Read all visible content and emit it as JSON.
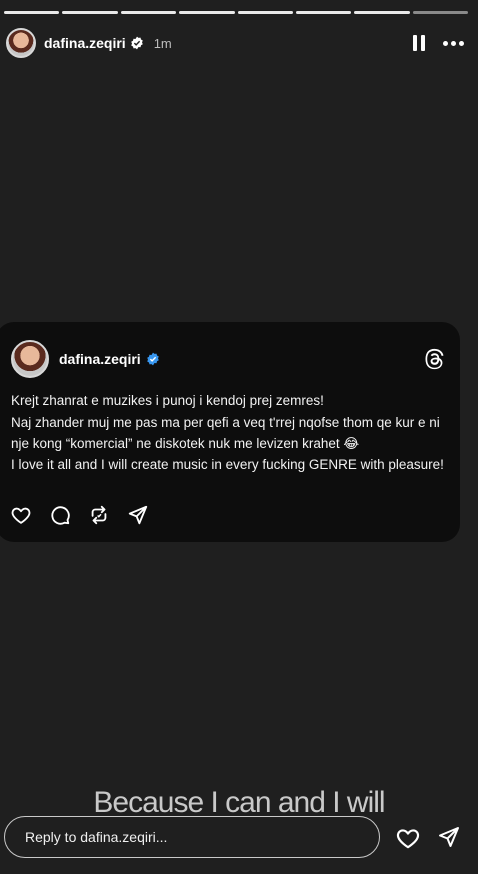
{
  "story": {
    "username": "dafina.zeqiri",
    "time": "1m",
    "segments": 8
  },
  "post": {
    "username": "dafina.zeqiri",
    "lines": [
      "Krejt zhanrat e muzikes i punoj i kendoj prej zemres!",
      "Naj zhander muj me pas ma per qefi a veq t'rrej nqofse thom qe kur e ni nje kong “komercial” ne diskotek nuk me levizen krahet 😂",
      "I love it all and I will create music in every fucking GENRE with pleasure!"
    ]
  },
  "caption": "Because I can and I will",
  "reply": {
    "placeholder": "Reply to dafina.zeqiri..."
  },
  "colors": {
    "background": "#1f1f1f",
    "card": "#0d0d0d",
    "verified": "#3897f0"
  },
  "icons": {
    "verified": "verified-badge-icon",
    "threads": "threads-logo-icon",
    "like": "heart-icon",
    "comment": "comment-icon",
    "repost": "repost-icon",
    "share": "send-icon",
    "pause": "pause-icon",
    "more": "more-icon"
  }
}
